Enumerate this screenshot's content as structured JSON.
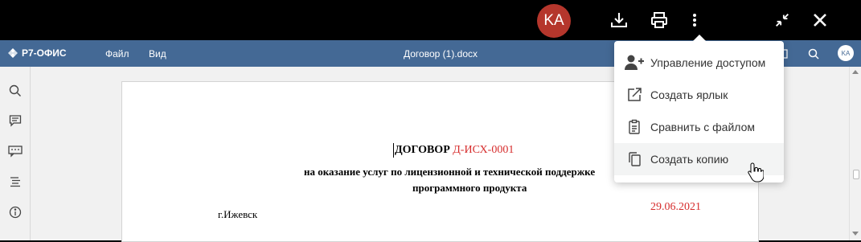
{
  "viewer": {
    "avatar_initials": "KA",
    "icons": [
      "download-icon",
      "print-icon",
      "more-vertical-icon",
      "collapse-icon",
      "close-icon"
    ]
  },
  "app": {
    "brand": "Р7-ОФИС",
    "menu": [
      "Файл",
      "Вид"
    ],
    "document_title": "Договор (1).docx",
    "user_initials": "KA",
    "accent_color": "#446995"
  },
  "left_panel": {
    "icons": [
      "search-icon",
      "comments-icon",
      "chat-icon",
      "navigation-icon",
      "info-icon"
    ]
  },
  "document": {
    "title": "ДОГОВОР",
    "number": "Д-ИСХ-0001",
    "subtitle_line1": "на оказание услуг по лицензионной и технической поддержке",
    "subtitle_line2": "программного продукта",
    "city": "г.Ижевск",
    "date": "29.06.2021",
    "highlight_color": "#d62c2c"
  },
  "dropdown": {
    "items": [
      {
        "label": "Управление доступом",
        "icon": "user-plus-icon"
      },
      {
        "label": "Создать ярлык",
        "icon": "external-link-icon"
      },
      {
        "label": "Сравнить с файлом",
        "icon": "clipboard-compare-icon"
      },
      {
        "label": "Создать копию",
        "icon": "copy-icon"
      }
    ],
    "hovered_index": 3
  }
}
